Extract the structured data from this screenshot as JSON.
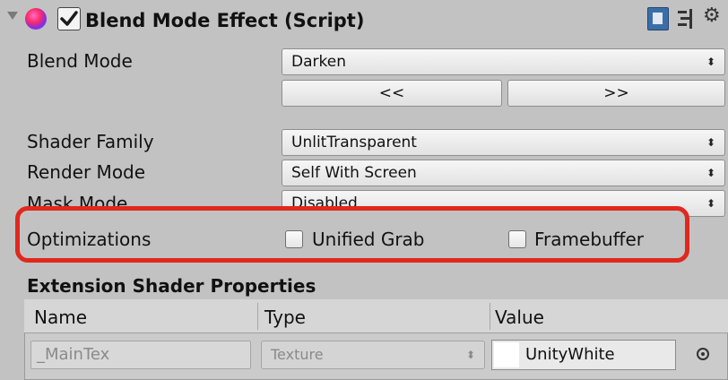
{
  "component": {
    "title": "Blend Mode Effect (Script)",
    "enabled": true,
    "icons": [
      "foldout-arrow-icon",
      "script-icon",
      "help-book-icon",
      "preset-icon",
      "gear-icon"
    ]
  },
  "properties": {
    "blend_mode": {
      "label": "Blend Mode",
      "value": "Darken"
    },
    "nav": {
      "prev_label": "<<",
      "next_label": ">>"
    },
    "shader_family": {
      "label": "Shader Family",
      "value": "UnlitTransparent"
    },
    "render_mode": {
      "label": "Render Mode",
      "value": "Self With Screen"
    },
    "mask_mode": {
      "label": "Mask Mode",
      "value": "Disabled"
    },
    "optimizations": {
      "label": "Optimizations",
      "unified_grab": {
        "label": "Unified Grab",
        "checked": false
      },
      "framebuffer": {
        "label": "Framebuffer",
        "checked": false
      }
    }
  },
  "extension": {
    "title": "Extension Shader Properties",
    "columns": [
      "Name",
      "Type",
      "Value"
    ],
    "rows": [
      {
        "name": "_MainTex",
        "type": "Texture",
        "value": "UnityWhite"
      }
    ]
  },
  "colors": {
    "background": "#c2c2c2",
    "highlight": "#e0281e"
  }
}
